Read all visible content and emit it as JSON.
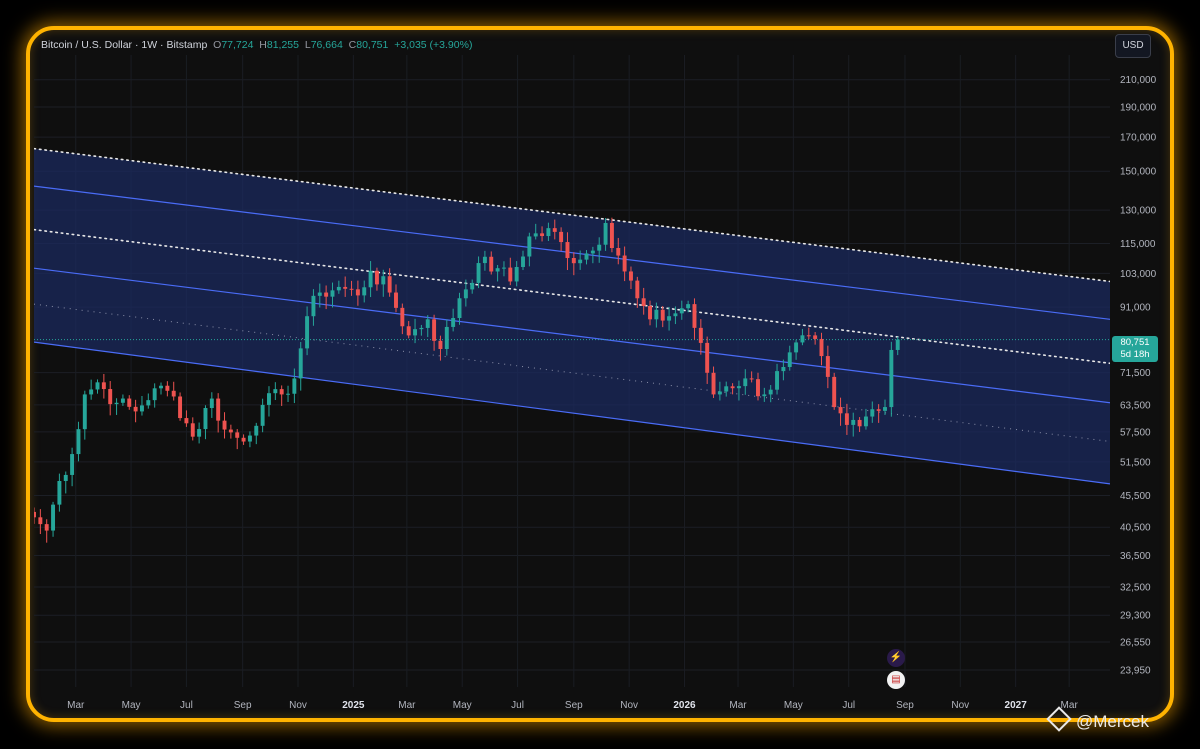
{
  "legend": {
    "symbol": "Bitcoin / U.S. Dollar · 1W · Bitstamp",
    "o_label": "O",
    "o": "77,724",
    "h_label": "H",
    "h": "81,255",
    "l_label": "L",
    "l": "76,664",
    "c_label": "C",
    "c": "80,751",
    "change": "+3,035 (+3.90%)"
  },
  "currency_button": "USD",
  "price_tag": {
    "price": "80,751",
    "countdown": "5d 18h"
  },
  "watermark": "@Mercek",
  "colors": {
    "up": "#26a69a",
    "down": "#ef5350",
    "channel_fill": "#1b2a5e",
    "channel_line": "#4a6cf7",
    "frame": "#ffb300"
  },
  "chart_data": {
    "type": "candlestick",
    "y_scale": "log",
    "ylim": [
      22500,
      230000
    ],
    "y_ticks": [
      210000,
      190000,
      170000,
      150000,
      130000,
      115000,
      103000,
      91000,
      80751,
      71500,
      63500,
      57500,
      51500,
      45500,
      40500,
      36500,
      32500,
      29300,
      26550,
      23950
    ],
    "y_tick_labels": [
      "210,000",
      "190,000",
      "170,000",
      "150,000",
      "130,000",
      "115,000",
      "103,000",
      "91,000",
      "80,751",
      "71,500",
      "63,500",
      "57,500",
      "51,500",
      "45,500",
      "40,500",
      "36,500",
      "32,500",
      "29,300",
      "26,550",
      "23,950"
    ],
    "x_tick_labels": [
      "Mar",
      "May",
      "Jul",
      "Sep",
      "Nov",
      "2025",
      "Mar",
      "May",
      "Jul",
      "Sep",
      "Nov",
      "2026",
      "Mar",
      "May",
      "Jul",
      "Sep",
      "Nov",
      "2027",
      "Mar"
    ],
    "x_tick_dates": [
      "2024-03-01",
      "2024-05-01",
      "2024-07-01",
      "2024-09-01",
      "2024-11-01",
      "2025-01-01",
      "2025-03-01",
      "2025-05-01",
      "2025-07-01",
      "2025-09-01",
      "2025-11-01",
      "2026-01-01",
      "2026-03-01",
      "2026-05-01",
      "2026-07-01",
      "2026-09-01",
      "2026-11-01",
      "2027-01-01",
      "2027-03-01"
    ],
    "last_close": 80751,
    "channel": {
      "start_date": "2024-01-15",
      "end_date": "2027-04-15",
      "lines": [
        {
          "style": "dotted",
          "start": 163000,
          "end": 100000
        },
        {
          "style": "solid",
          "start": 142000,
          "end": 87000
        },
        {
          "style": "dotted",
          "start": 121000,
          "end": 74000
        },
        {
          "style": "solid",
          "start": 105000,
          "end": 64000
        },
        {
          "style": "dotted-faint",
          "start": 92000,
          "end": 55500
        },
        {
          "style": "solid",
          "start": 80000,
          "end": 47500
        }
      ]
    },
    "anchors": [
      [
        "2024-01-15",
        42000
      ],
      [
        "2024-01-29",
        40000
      ],
      [
        "2024-02-12",
        48000
      ],
      [
        "2024-02-26",
        53000
      ],
      [
        "2024-03-11",
        66000
      ],
      [
        "2024-03-25",
        69000
      ],
      [
        "2024-04-15",
        64000
      ],
      [
        "2024-05-06",
        62000
      ],
      [
        "2024-05-27",
        67500
      ],
      [
        "2024-06-17",
        65500
      ],
      [
        "2024-07-08",
        56500
      ],
      [
        "2024-07-29",
        65000
      ],
      [
        "2024-08-12",
        58000
      ],
      [
        "2024-09-02",
        55500
      ],
      [
        "2024-09-23",
        63500
      ],
      [
        "2024-10-14",
        66000
      ],
      [
        "2024-10-28",
        70000
      ],
      [
        "2024-11-11",
        88000
      ],
      [
        "2024-11-25",
        96000
      ],
      [
        "2024-12-16",
        98000
      ],
      [
        "2025-01-06",
        95000
      ],
      [
        "2025-01-20",
        104000
      ],
      [
        "2025-02-10",
        96000
      ],
      [
        "2025-03-03",
        82000
      ],
      [
        "2025-03-24",
        87000
      ],
      [
        "2025-04-07",
        78000
      ],
      [
        "2025-04-28",
        94000
      ],
      [
        "2025-05-19",
        107000
      ],
      [
        "2025-06-09",
        105000
      ],
      [
        "2025-06-23",
        100000
      ],
      [
        "2025-07-14",
        118000
      ],
      [
        "2025-08-11",
        120000
      ],
      [
        "2025-08-25",
        109000
      ],
      [
        "2025-09-22",
        112000
      ],
      [
        "2025-10-06",
        124000
      ],
      [
        "2025-10-20",
        110000
      ],
      [
        "2025-11-10",
        94000
      ],
      [
        "2025-11-24",
        87000
      ],
      [
        "2025-12-15",
        88000
      ],
      [
        "2026-01-05",
        92000
      ],
      [
        "2026-02-02",
        66000
      ],
      [
        "2026-02-16",
        68000
      ],
      [
        "2026-03-09",
        70000
      ],
      [
        "2026-03-30",
        66000
      ],
      [
        "2026-04-20",
        73000
      ],
      [
        "2026-05-18",
        82000
      ],
      [
        "2026-06-01",
        76000
      ],
      [
        "2026-06-15",
        63000
      ],
      [
        "2026-06-29",
        59000
      ],
      [
        "2026-07-27",
        62500
      ],
      [
        "2026-08-10",
        63000
      ],
      [
        "2026-08-17",
        77724
      ],
      [
        "2026-08-24",
        80751
      ]
    ]
  }
}
